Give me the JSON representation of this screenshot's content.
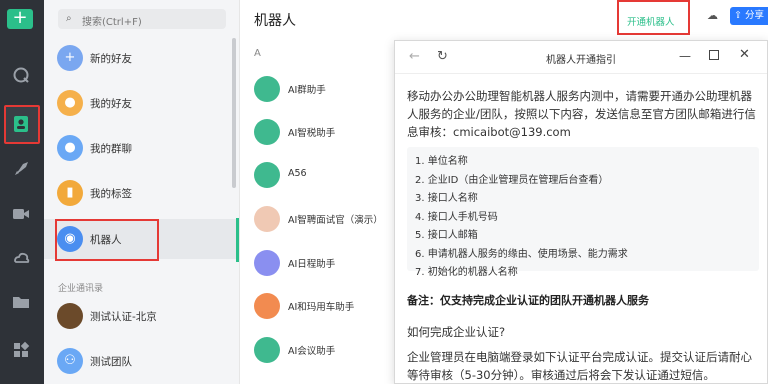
{
  "rail": {
    "add_label": "+",
    "items": [
      {
        "name": "chat-icon"
      },
      {
        "name": "contacts-icon"
      },
      {
        "name": "rocket-icon"
      },
      {
        "name": "video-icon"
      },
      {
        "name": "cloud-icon"
      },
      {
        "name": "folder-icon"
      },
      {
        "name": "apps-icon"
      }
    ]
  },
  "search": {
    "placeholder": "搜索(Ctrl+F)"
  },
  "contacts": {
    "items": [
      {
        "label": "新的好友",
        "color": "#7aa7f0"
      },
      {
        "label": "我的好友",
        "color": "#f5b04b"
      },
      {
        "label": "我的群聊",
        "color": "#6aa8f5"
      },
      {
        "label": "我的标签",
        "color": "#f2a93b"
      },
      {
        "label": "机器人",
        "color": "#4a8ef0"
      }
    ],
    "section_title": "企业通讯录",
    "org_items": [
      {
        "label": "测试认证-北京"
      },
      {
        "label": "测试团队"
      }
    ]
  },
  "main": {
    "title": "机器人",
    "open_robot_button": "开通机器人",
    "share_button": "分享",
    "letter": "A",
    "bots": [
      {
        "label": "AI群助手",
        "color": "#3fb98f"
      },
      {
        "label": "AI智税助手",
        "color": "#3fb98f"
      },
      {
        "label": "A56",
        "color": "#3fb98f"
      },
      {
        "label": "AI智聘面试官（演示）",
        "color": "#f0c9b4"
      },
      {
        "label": "AI日程助手",
        "color": "#8a8ff0"
      },
      {
        "label": "AI和玛用车助手",
        "color": "#f28b50"
      },
      {
        "label": "AI会议助手",
        "color": "#3fb98f"
      }
    ]
  },
  "dialog": {
    "title": "机器人开通指引",
    "intro": "移动办公办公助理智能机器人服务内测中，请需要开通办公助理机器人服务的企业/团队，按照以下内容，发送信息至官方团队邮箱进行信息审核：cmicaibot@139.com",
    "steps": [
      "1. 单位名称",
      "2. 企业ID（由企业管理员在管理后台查看）",
      "3. 接口人名称",
      "4. 接口人手机号码",
      "5. 接口人邮箱",
      "6. 申请机器人服务的缘由、使用场景、能力需求",
      "7. 初始化的机器人名称"
    ],
    "note": "备注：仅支持完成企业认证的团队开通机器人服务",
    "question": "如何完成企业认证?",
    "answer": "企业管理员在电脑端登录如下认证平台完成认证。提交认证后请耐心等待审核（5-30分钟）。审核通过后将会下发认证通过短信。"
  }
}
